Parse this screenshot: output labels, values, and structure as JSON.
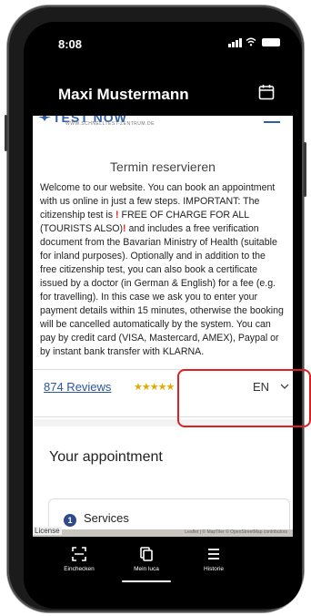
{
  "status_bar": {
    "time": "8:08"
  },
  "header": {
    "title": "Maxi Mustermann"
  },
  "website": {
    "logo_text": "TEST NOW",
    "logo_sub": "WWW.SCHNELLTEST-ZENTRUM.DE",
    "page_title": "Termin reservieren",
    "intro_1": "Welcome to our website. You can book an appointment with us online in just a few steps. IMPORTANT: The citizenship test is ",
    "intro_2": " FREE OF CHARGE FOR ALL (TOURISTS ALSO)",
    "intro_3": " and includes a free verification document from the Bavarian Ministry of Health (suitable for inland purposes). Optionally and in addition to the free citizenship test, you can also book a certificate issued by a doctor (in German & English) for a fee (e.g. for travelling). In this case we ask you to enter your payment details within 15 minutes, otherwise the booking will be cancelled automatically by the system. You can pay by credit card (VISA, Mastercard, AMEX), Paypal or by instant bank transfer with KLARNA.",
    "exclamation": "!",
    "reviews_link": "874 Reviews",
    "stars": "★★★★★",
    "language": "EN",
    "appointment_title": "Your appointment",
    "services_step": "1",
    "services_label": "Services",
    "map_license": "License",
    "map_attribution": "Leaflet | © MapTiler © OpenStreetMap contributors"
  },
  "tabbar": {
    "items": [
      {
        "label": "Einchecken",
        "icon": "checkin-icon"
      },
      {
        "label": "Mein luca",
        "icon": "luca-icon"
      },
      {
        "label": "Historie",
        "icon": "history-icon"
      }
    ]
  },
  "colors": {
    "accent": "#2f5fa8",
    "highlight": "#e02020",
    "exclamation": "#e0261e"
  }
}
